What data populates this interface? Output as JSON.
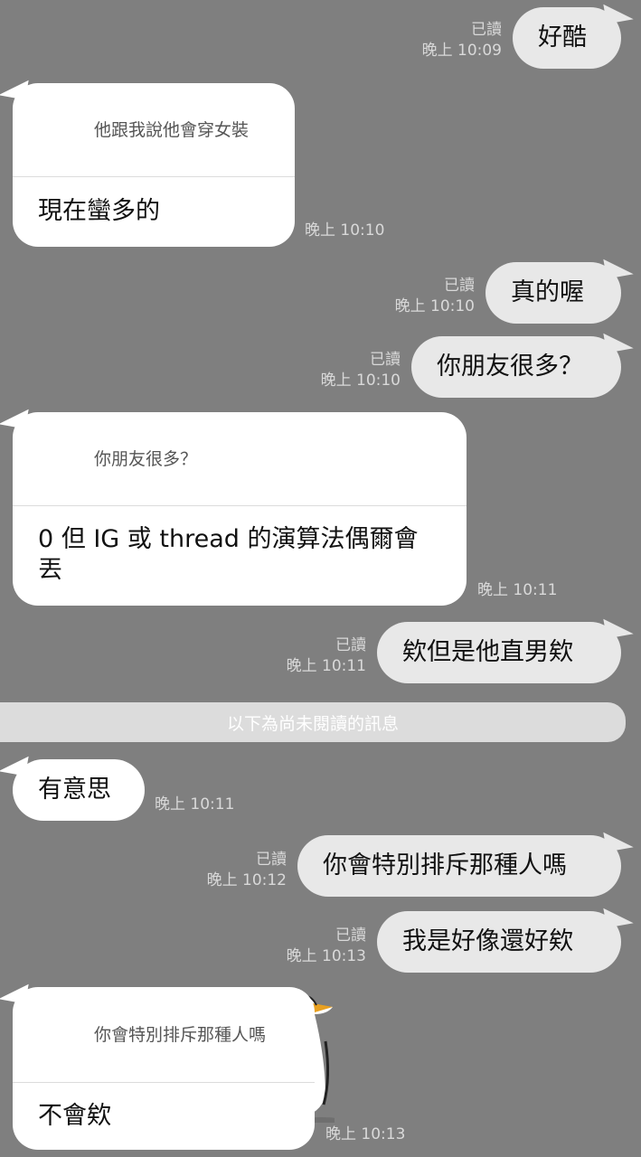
{
  "messages": [
    {
      "text": "好酷",
      "read": "已讀",
      "time": "晚上 10:09"
    },
    {
      "quote": "他跟我說他會穿女裝",
      "text": "現在蠻多的",
      "time": "晚上 10:10"
    },
    {
      "text": "真的喔",
      "read": "已讀",
      "time": "晚上 10:10"
    },
    {
      "text": "你朋友很多？",
      "read": "已讀",
      "time": "晚上 10:10"
    },
    {
      "quote": "你朋友很多？",
      "text_line1": "0 但 IG 或 thread 的演算法偶爾會",
      "text_line2": "丟",
      "time": "晚上 10:11"
    },
    {
      "text": "欸但是他直男欸",
      "read": "已讀",
      "time": "晚上 10:11"
    },
    {
      "text": "有意思",
      "time": "晚上 10:11"
    },
    {
      "text": "你會特別排斥那種人嗎",
      "read": "已讀",
      "time": "晚上 10:12"
    },
    {
      "text": "我是好像還好欸",
      "read": "已讀",
      "time": "晚上 10:13"
    },
    {
      "quote": "你會特別排斥那種人嗎",
      "text": "不會欸",
      "time": "晚上 10:13"
    }
  ],
  "divider": "以下為尚未閱讀的訊息",
  "colors": {
    "background": "#7f7f7f",
    "sent_bubble": "#e8e8e8",
    "received_bubble": "#ffffff"
  }
}
